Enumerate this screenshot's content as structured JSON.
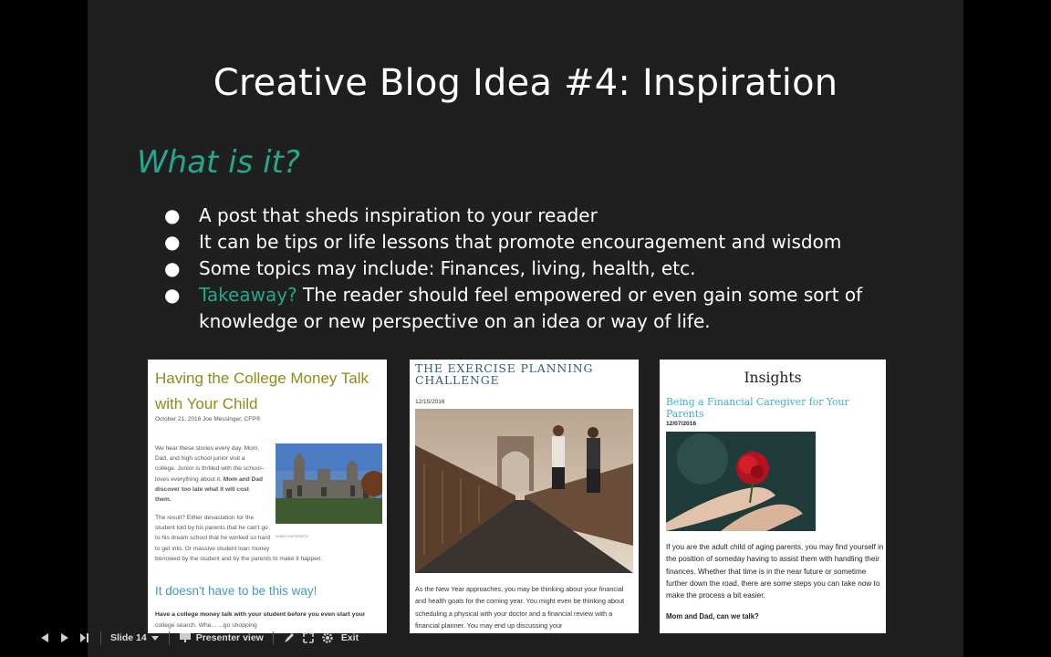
{
  "slide": {
    "title": "Creative Blog Idea #4: Inspiration",
    "subtitle": "What is it?",
    "bullets": [
      {
        "text": "A post that sheds inspiration to your reader"
      },
      {
        "text": "It can be tips or life lessons that promote encouragement and wisdom"
      },
      {
        "text": "Some topics may include: Finances, living, health, etc."
      },
      {
        "accent": "Takeaway?",
        "text": " The reader should feel empowered or even gain some sort of knowledge or new perspective on an idea or way of life."
      }
    ],
    "bullet_glyph": "●",
    "accent_color": "#26a68c"
  },
  "cards": {
    "college": {
      "title": "Having the College Money Talk with Your Child",
      "meta": "October 21, 2016 Joe Messinger, CFP®",
      "para1": "We hear these stories every day. Mom, Dad, and high school junior visit a college. Junior is thrilled with the school–loves everything about it.",
      "para1_bold": " Mom and Dad discover too late what it will cost them.",
      "para2": "The result? Either devastation for the student told by his parents that he can't go to his dream school that he worked so hard to get into. Or massive student loan money",
      "para2b": "borrowed by the student and by the parents to make it happen.",
      "caption": "DUKE UNIVERSITY",
      "heading2": "It doesn't have to be this way!",
      "para3": "Have a college money talk with your student before you even start your",
      "para4": "college search. Whe... ...go shopping"
    },
    "exercise": {
      "title": "THE EXERCISE PLANNING CHALLENGE",
      "date": "12/15/2016",
      "para": "As the New Year approaches, you may be thinking about your financial and health goals for the coming year.  You might even be thinking about scheduling a physical with your doctor and a financial review with a financial planner.  You may end up discussing your"
    },
    "insights": {
      "title": "Insights",
      "subtitle": "Being a Financial Caregiver for Your Parents",
      "date": "12/07/2016",
      "para": "If you are the adult child of aging parents, you may find yourself in the position of someday having to assist them with handling their finances. Whether that time is in the near future or sometime further down the road, there are some steps you can take now to make the process a bit easier.",
      "para2": "Mom and Dad, can we talk?"
    }
  },
  "controls": {
    "slide_label": "Slide 14",
    "presenter_view": "Presenter view",
    "exit": "Exit",
    "icons": [
      "prev-icon",
      "play-icon",
      "next-icon",
      "dropdown-icon",
      "presenter-icon",
      "pen-icon",
      "fullscreen-icon",
      "settings-icon"
    ]
  }
}
